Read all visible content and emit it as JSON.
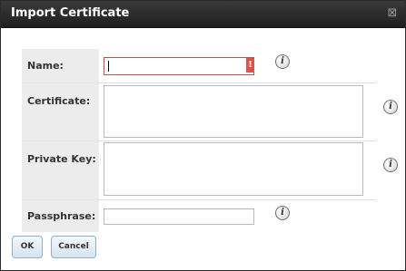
{
  "dialog": {
    "title": "Import Certificate",
    "close_glyph": "⊠"
  },
  "fields": {
    "name": {
      "label": "Name:",
      "value": "",
      "error_glyph": "!"
    },
    "certificate": {
      "label": "Certificate:",
      "value": ""
    },
    "private_key": {
      "label": "Private Key:",
      "value": ""
    },
    "passphrase": {
      "label": "Passphrase:",
      "value": ""
    }
  },
  "info_glyph": "i",
  "buttons": {
    "ok": "OK",
    "cancel": "Cancel"
  },
  "colors": {
    "titlebar": "#2b2b2b",
    "label_bg": "#ececec",
    "error": "#d9534f"
  }
}
